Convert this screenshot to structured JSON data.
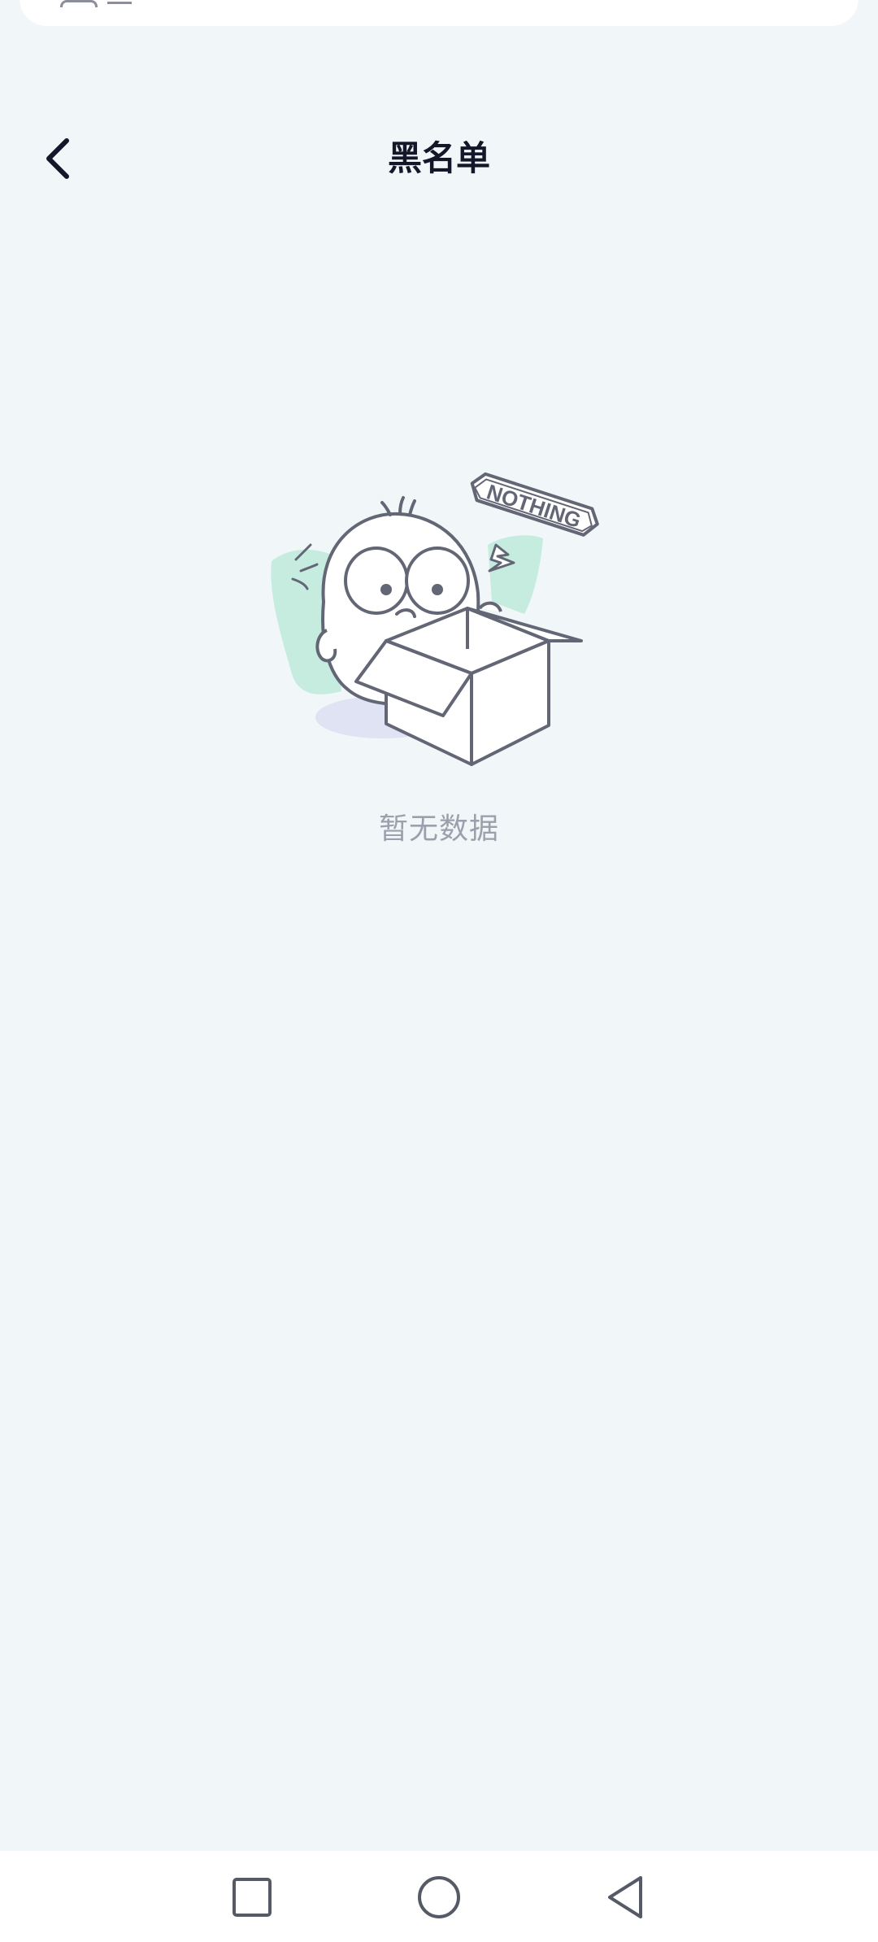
{
  "header": {
    "title": "黑名单",
    "back_icon": "chevron-left-icon"
  },
  "empty_state": {
    "badge_text": "NOTHING",
    "message": "暂无数据",
    "illustration": "empty-box-mascot-illustration"
  },
  "nav_bar": {
    "recents_icon": "square-icon",
    "home_icon": "circle-icon",
    "back_icon": "triangle-back-icon"
  },
  "colors": {
    "background": "#f1f6f9",
    "title": "#13172a",
    "empty_text": "#9ca0ad",
    "illustration_stroke": "#636675",
    "illustration_accent_green": "#c6ecdf",
    "illustration_accent_blue": "#dfe3f4"
  }
}
